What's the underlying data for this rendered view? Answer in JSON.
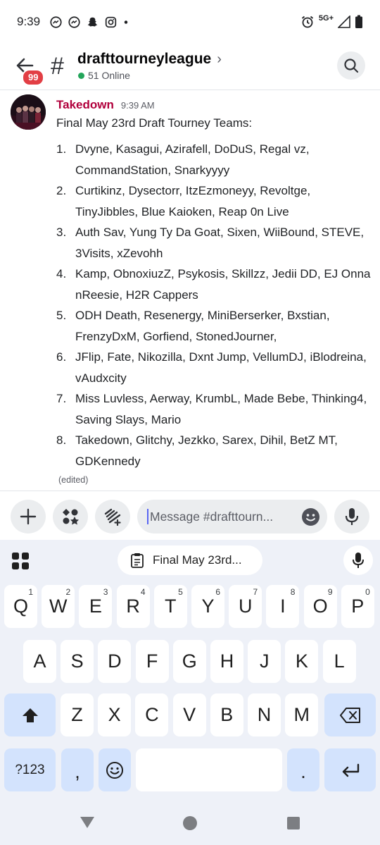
{
  "status_bar": {
    "time": "9:39",
    "network": "5G+",
    "icons": [
      "messenger-icon",
      "messenger-icon",
      "snapchat-icon",
      "instagram-icon",
      "dot-icon"
    ]
  },
  "header": {
    "unread_badge": "99",
    "channel_name": "drafttourneyleague",
    "online_count": "51 Online"
  },
  "message": {
    "author": "Takedown",
    "author_color": "#b1003c",
    "timestamp": "9:39 AM",
    "intro": "Final May 23rd Draft Tourney Teams:",
    "teams": [
      {
        "num": "1.",
        "text": "Dvyne, Kasagui, Azirafell, DoDuS, Regal vz, CommandStation, Snarkyyyy"
      },
      {
        "num": "2.",
        "text": "Curtikinz, Dysectorr, ItzEzmoneyy, Revoltge, TinyJibbles, Blue Kaioken, Reap 0n Live"
      },
      {
        "num": "3.",
        "text": "Auth Sav, Yung Ty Da Goat, Sixen, WiiBound, STEVE, 3Visits, xZevohh"
      },
      {
        "num": "4.",
        "text": "Kamp, ObnoxiuzZ, Psykosis, Skillzz, Jedii DD, EJ Onna nReesie, H2R Cappers"
      },
      {
        "num": "5.",
        "text": "ODH Death, Resenergy, MiniBerserker, Bxstian, FrenzyDxM, Gorfiend, StonedJourner,"
      },
      {
        "num": "6.",
        "text": "JFlip, Fate, Nikozilla, Dxnt Jump, VellumDJ, iBlodreina, vAudxcity"
      },
      {
        "num": "7.",
        "text": "Miss Luvless, Aerway, KrumbL, Made Bebe, Thinking4, Saving Slays, Mario"
      },
      {
        "num": "8.",
        "text": "Takedown, Glitchy, Jezkko, Sarex, Dihil, BetZ MT, GDKennedy"
      }
    ],
    "edited_label": "(edited)"
  },
  "composer": {
    "placeholder": "Message #drafttourn..."
  },
  "keyboard": {
    "clipboard_chip": "Final May 23rd...",
    "row1": [
      {
        "k": "Q",
        "h": "1"
      },
      {
        "k": "W",
        "h": "2"
      },
      {
        "k": "E",
        "h": "3"
      },
      {
        "k": "R",
        "h": "4"
      },
      {
        "k": "T",
        "h": "5"
      },
      {
        "k": "Y",
        "h": "6"
      },
      {
        "k": "U",
        "h": "7"
      },
      {
        "k": "I",
        "h": "8"
      },
      {
        "k": "O",
        "h": "9"
      },
      {
        "k": "P",
        "h": "0"
      }
    ],
    "row2": [
      "A",
      "S",
      "D",
      "F",
      "G",
      "H",
      "J",
      "K",
      "L"
    ],
    "row3": [
      "Z",
      "X",
      "C",
      "V",
      "B",
      "N",
      "M"
    ],
    "sym_key": "?123",
    "comma_key": ",",
    "period_key": "."
  }
}
